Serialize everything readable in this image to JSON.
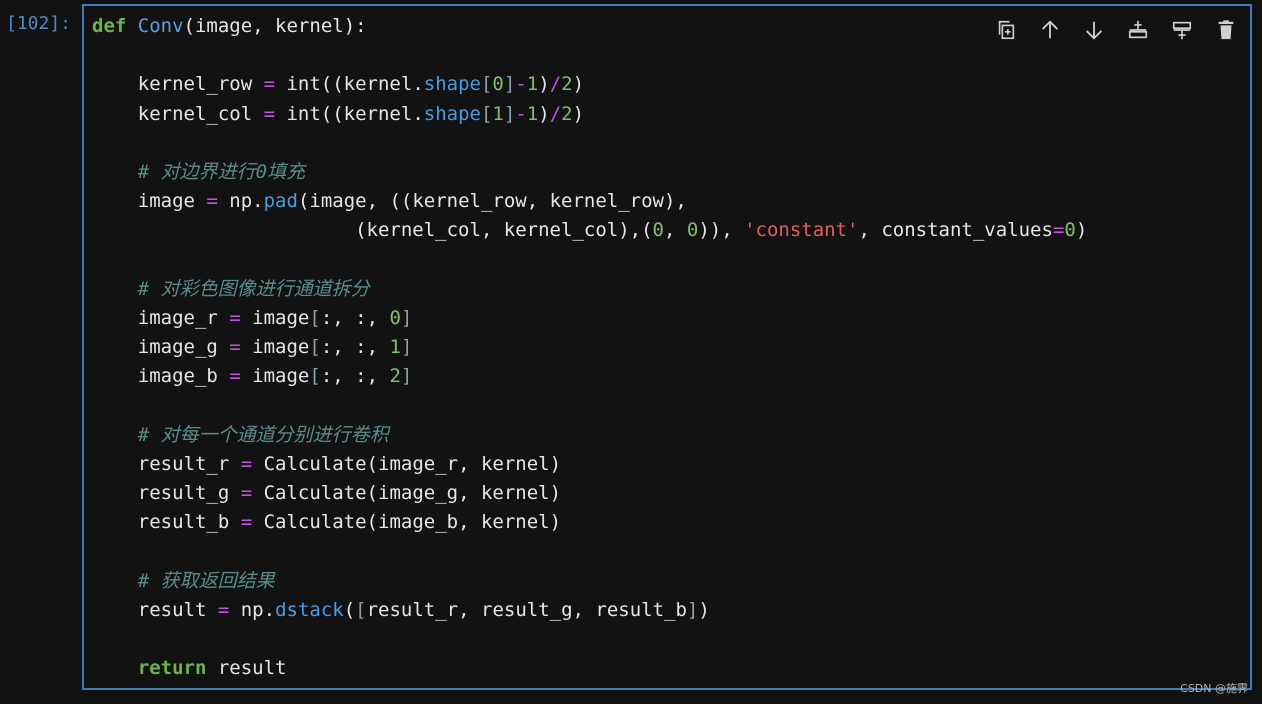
{
  "cell": {
    "prompt": "[102]:",
    "toolbar": [
      {
        "name": "duplicate-cell-icon",
        "label": "Duplicate"
      },
      {
        "name": "move-up-icon",
        "label": "Move up"
      },
      {
        "name": "move-down-icon",
        "label": "Move down"
      },
      {
        "name": "insert-above-icon",
        "label": "Insert above"
      },
      {
        "name": "insert-below-icon",
        "label": "Insert below"
      },
      {
        "name": "delete-cell-icon",
        "label": "Delete"
      }
    ],
    "code_lines": [
      [
        [
          "kw",
          "def"
        ],
        [
          "t",
          " "
        ],
        [
          "fn",
          "Conv"
        ],
        [
          "t",
          "(image, kernel):"
        ]
      ],
      [],
      [
        [
          "t",
          "    kernel_row "
        ],
        [
          "op",
          "="
        ],
        [
          "t",
          " int((kernel."
        ],
        [
          "attr",
          "shape"
        ],
        [
          "bkt",
          "["
        ],
        [
          "num",
          "0"
        ],
        [
          "bkt",
          "]"
        ],
        [
          "op",
          "-"
        ],
        [
          "num",
          "1"
        ],
        [
          "t",
          ")"
        ],
        [
          "op",
          "/"
        ],
        [
          "num",
          "2"
        ],
        [
          "t",
          ")"
        ]
      ],
      [
        [
          "t",
          "    kernel_col "
        ],
        [
          "op",
          "="
        ],
        [
          "t",
          " int((kernel."
        ],
        [
          "attr",
          "shape"
        ],
        [
          "bkt",
          "["
        ],
        [
          "num",
          "1"
        ],
        [
          "bkt",
          "]"
        ],
        [
          "op",
          "-"
        ],
        [
          "num",
          "1"
        ],
        [
          "t",
          ")"
        ],
        [
          "op",
          "/"
        ],
        [
          "num",
          "2"
        ],
        [
          "t",
          ")"
        ]
      ],
      [],
      [
        [
          "t",
          "    "
        ],
        [
          "cm",
          "# 对边界进行0填充"
        ]
      ],
      [
        [
          "t",
          "    image "
        ],
        [
          "op",
          "="
        ],
        [
          "t",
          " np."
        ],
        [
          "attr",
          "pad"
        ],
        [
          "t",
          "(image, ((kernel_row, kernel_row),"
        ]
      ],
      [
        [
          "t",
          "                       (kernel_col, kernel_col),("
        ],
        [
          "num",
          "0"
        ],
        [
          "t",
          ", "
        ],
        [
          "num",
          "0"
        ],
        [
          "t",
          ")), "
        ],
        [
          "str",
          "'constant'"
        ],
        [
          "t",
          ", constant_values"
        ],
        [
          "op",
          "="
        ],
        [
          "num",
          "0"
        ],
        [
          "t",
          ")"
        ]
      ],
      [],
      [
        [
          "t",
          "    "
        ],
        [
          "cm",
          "# 对彩色图像进行通道拆分"
        ]
      ],
      [
        [
          "t",
          "    image_r "
        ],
        [
          "op",
          "="
        ],
        [
          "t",
          " image"
        ],
        [
          "bkt",
          "["
        ],
        [
          "t",
          ":, :, "
        ],
        [
          "num",
          "0"
        ],
        [
          "bkt",
          "]"
        ]
      ],
      [
        [
          "t",
          "    image_g "
        ],
        [
          "op",
          "="
        ],
        [
          "t",
          " image"
        ],
        [
          "bkt",
          "["
        ],
        [
          "t",
          ":, :, "
        ],
        [
          "num",
          "1"
        ],
        [
          "bkt",
          "]"
        ]
      ],
      [
        [
          "t",
          "    image_b "
        ],
        [
          "op",
          "="
        ],
        [
          "t",
          " image"
        ],
        [
          "bkt",
          "["
        ],
        [
          "t",
          ":, :, "
        ],
        [
          "num",
          "2"
        ],
        [
          "bkt",
          "]"
        ]
      ],
      [],
      [
        [
          "t",
          "    "
        ],
        [
          "cm",
          "# 对每一个通道分别进行卷积"
        ]
      ],
      [
        [
          "t",
          "    result_r "
        ],
        [
          "op",
          "="
        ],
        [
          "t",
          " Calculate(image_r, kernel)"
        ]
      ],
      [
        [
          "t",
          "    result_g "
        ],
        [
          "op",
          "="
        ],
        [
          "t",
          " Calculate(image_g, kernel)"
        ]
      ],
      [
        [
          "t",
          "    result_b "
        ],
        [
          "op",
          "="
        ],
        [
          "t",
          " Calculate(image_b, kernel)"
        ]
      ],
      [],
      [
        [
          "t",
          "    "
        ],
        [
          "cm",
          "# 获取返回结果"
        ]
      ],
      [
        [
          "t",
          "    result "
        ],
        [
          "op",
          "="
        ],
        [
          "t",
          " np."
        ],
        [
          "attr",
          "dstack"
        ],
        [
          "t",
          "("
        ],
        [
          "bkt",
          "["
        ],
        [
          "t",
          "result_r, result_g, result_b"
        ],
        [
          "bkt",
          "]"
        ],
        [
          "t",
          ")"
        ]
      ],
      [],
      [
        [
          "t",
          "    "
        ],
        [
          "kw",
          "return"
        ],
        [
          "t",
          " result"
        ]
      ]
    ]
  },
  "watermark": "CSDN @施霁",
  "colors": {
    "border": "#3e7dbd",
    "prompt": "#4f88c6",
    "keyword": "#6fb24a",
    "function": "#5d9fe0",
    "number": "#7fbf6c",
    "operator": "#c056e0",
    "string": "#e06060",
    "comment": "#5a8c8c"
  }
}
